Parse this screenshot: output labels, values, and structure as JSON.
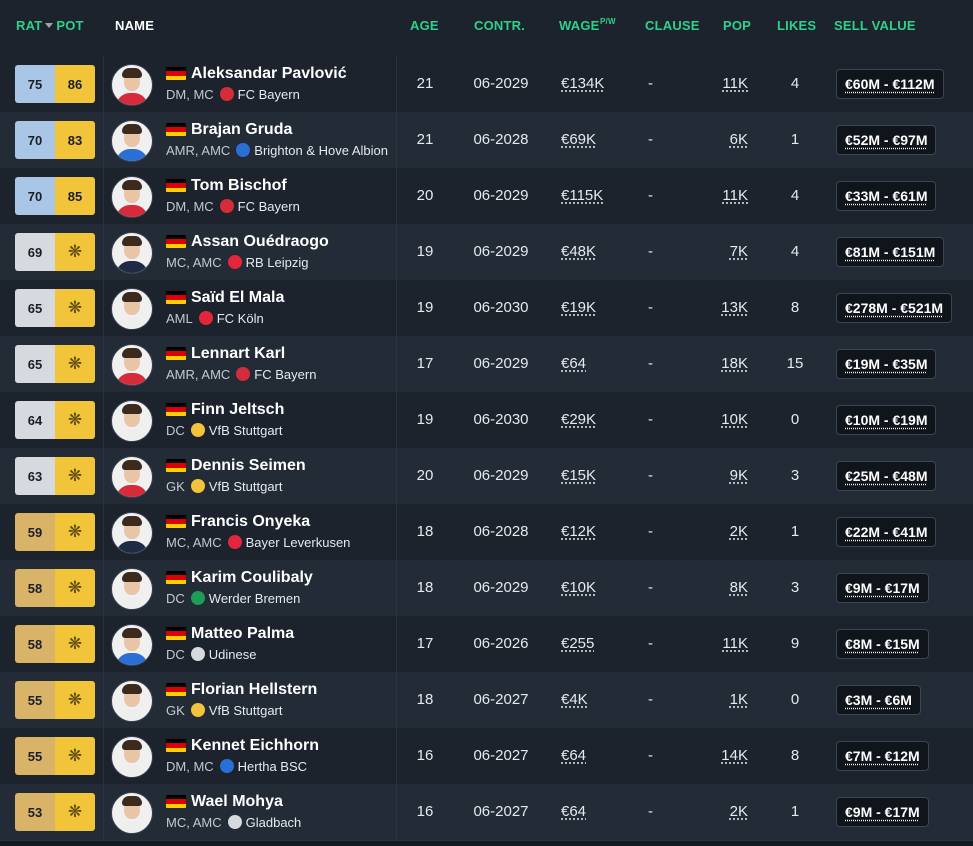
{
  "header": {
    "rat": "RAT",
    "pot": "POT",
    "name": "NAME",
    "age": "AGE",
    "contract": "CONTR.",
    "wage": "WAGE",
    "wage_unit": "P/W",
    "clause": "CLAUSE",
    "pop": "POP",
    "likes": "LIKES",
    "sell_value": "SELL VALUE"
  },
  "colors": {
    "accent_green": "#2fd08a",
    "rat_blue": "#a9c6e6",
    "rat_silver": "#d6d9de",
    "rat_bronze": "#d9b468",
    "pot_gold": "#f2c43a"
  },
  "rows": [
    {
      "rat": "75",
      "rat_tier": "blue",
      "pot": "86",
      "pot_icon": false,
      "name": "Aleksandar Pavlović",
      "pos": "DM, MC",
      "club": "FC Bayern",
      "club_icon": "bayern-crest-icon",
      "age": "21",
      "contract": "06-2029",
      "wage": "€134K",
      "clause": "-",
      "pop": "11K",
      "likes": "4",
      "sell": "€60M - €112M",
      "shirt": "#d62b3a"
    },
    {
      "rat": "70",
      "rat_tier": "blue",
      "pot": "83",
      "pot_icon": false,
      "name": "Brajan Gruda",
      "pos": "AMR, AMC",
      "club": "Brighton & Hove Albion",
      "club_icon": "brighton-crest-icon",
      "age": "21",
      "contract": "06-2028",
      "wage": "€69K",
      "clause": "-",
      "pop": "6K",
      "likes": "1",
      "sell": "€52M - €97M",
      "shirt": "#2a6fd6"
    },
    {
      "rat": "70",
      "rat_tier": "blue",
      "pot": "85",
      "pot_icon": false,
      "name": "Tom Bischof",
      "pos": "DM, MC",
      "club": "FC Bayern",
      "club_icon": "bayern-crest-icon",
      "age": "20",
      "contract": "06-2029",
      "wage": "€115K",
      "clause": "-",
      "pop": "11K",
      "likes": "4",
      "sell": "€33M - €61M",
      "shirt": "#d62b3a"
    },
    {
      "rat": "69",
      "rat_tier": "silver",
      "pot": "",
      "pot_icon": true,
      "name": "Assan Ouédraogo",
      "pos": "MC, AMC",
      "club": "RB Leipzig",
      "club_icon": "leipzig-crest-icon",
      "age": "19",
      "contract": "06-2029",
      "wage": "€48K",
      "clause": "-",
      "pop": "7K",
      "likes": "4",
      "sell": "€81M - €151M",
      "shirt": "#1f2a44"
    },
    {
      "rat": "65",
      "rat_tier": "silver",
      "pot": "",
      "pot_icon": true,
      "name": "Saïd El Mala",
      "pos": "AML",
      "club": "FC Köln",
      "club_icon": "koln-crest-icon",
      "age": "19",
      "contract": "06-2030",
      "wage": "€19K",
      "clause": "-",
      "pop": "13K",
      "likes": "8",
      "sell": "€278M - €521M",
      "shirt": "#eeeeee"
    },
    {
      "rat": "65",
      "rat_tier": "silver",
      "pot": "",
      "pot_icon": true,
      "name": "Lennart Karl",
      "pos": "AMR, AMC",
      "club": "FC Bayern",
      "club_icon": "bayern-crest-icon",
      "age": "17",
      "contract": "06-2029",
      "wage": "€64",
      "clause": "-",
      "pop": "18K",
      "likes": "15",
      "sell": "€19M - €35M",
      "shirt": "#d62b3a"
    },
    {
      "rat": "64",
      "rat_tier": "silver",
      "pot": "",
      "pot_icon": true,
      "name": "Finn Jeltsch",
      "pos": "DC",
      "club": "VfB Stuttgart",
      "club_icon": "stuttgart-crest-icon",
      "age": "19",
      "contract": "06-2030",
      "wage": "€29K",
      "clause": "-",
      "pop": "10K",
      "likes": "0",
      "sell": "€10M - €19M",
      "shirt": "#eeeeee"
    },
    {
      "rat": "63",
      "rat_tier": "silver",
      "pot": "",
      "pot_icon": true,
      "name": "Dennis Seimen",
      "pos": "GK",
      "club": "VfB Stuttgart",
      "club_icon": "stuttgart-crest-icon",
      "age": "20",
      "contract": "06-2029",
      "wage": "€15K",
      "clause": "-",
      "pop": "9K",
      "likes": "3",
      "sell": "€25M - €48M",
      "shirt": "#d62b3a"
    },
    {
      "rat": "59",
      "rat_tier": "bronze",
      "pot": "",
      "pot_icon": true,
      "name": "Francis Onyeka",
      "pos": "MC, AMC",
      "club": "Bayer Leverkusen",
      "club_icon": "leverkusen-crest-icon",
      "age": "18",
      "contract": "06-2028",
      "wage": "€12K",
      "clause": "-",
      "pop": "2K",
      "likes": "1",
      "sell": "€22M - €41M",
      "shirt": "#1f2a44"
    },
    {
      "rat": "58",
      "rat_tier": "bronze",
      "pot": "",
      "pot_icon": true,
      "name": "Karim Coulibaly",
      "pos": "DC",
      "club": "Werder Bremen",
      "club_icon": "bremen-crest-icon",
      "age": "18",
      "contract": "06-2029",
      "wage": "€10K",
      "clause": "-",
      "pop": "8K",
      "likes": "3",
      "sell": "€9M - €17M",
      "shirt": "#eeeeee"
    },
    {
      "rat": "58",
      "rat_tier": "bronze",
      "pot": "",
      "pot_icon": true,
      "name": "Matteo Palma",
      "pos": "DC",
      "club": "Udinese",
      "club_icon": "udinese-crest-icon",
      "age": "17",
      "contract": "06-2026",
      "wage": "€255",
      "clause": "-",
      "pop": "11K",
      "likes": "9",
      "sell": "€8M - €15M",
      "shirt": "#2a6fd6"
    },
    {
      "rat": "55",
      "rat_tier": "bronze",
      "pot": "",
      "pot_icon": true,
      "name": "Florian Hellstern",
      "pos": "GK",
      "club": "VfB Stuttgart",
      "club_icon": "stuttgart-crest-icon",
      "age": "18",
      "contract": "06-2027",
      "wage": "€4K",
      "clause": "-",
      "pop": "1K",
      "likes": "0",
      "sell": "€3M - €6M",
      "shirt": "#eeeeee"
    },
    {
      "rat": "55",
      "rat_tier": "bronze",
      "pot": "",
      "pot_icon": true,
      "name": "Kennet Eichhorn",
      "pos": "DM, MC",
      "club": "Hertha BSC",
      "club_icon": "hertha-crest-icon",
      "age": "16",
      "contract": "06-2027",
      "wage": "€64",
      "clause": "-",
      "pop": "14K",
      "likes": "8",
      "sell": "€7M - €12M",
      "shirt": "#eeeeee"
    },
    {
      "rat": "53",
      "rat_tier": "bronze",
      "pot": "",
      "pot_icon": true,
      "name": "Wael Mohya",
      "pos": "MC, AMC",
      "club": "Gladbach",
      "club_icon": "gladbach-crest-icon",
      "age": "16",
      "contract": "06-2027",
      "wage": "€64",
      "clause": "-",
      "pop": "2K",
      "likes": "1",
      "sell": "€9M - €17M",
      "shirt": "#eeeeee"
    }
  ]
}
